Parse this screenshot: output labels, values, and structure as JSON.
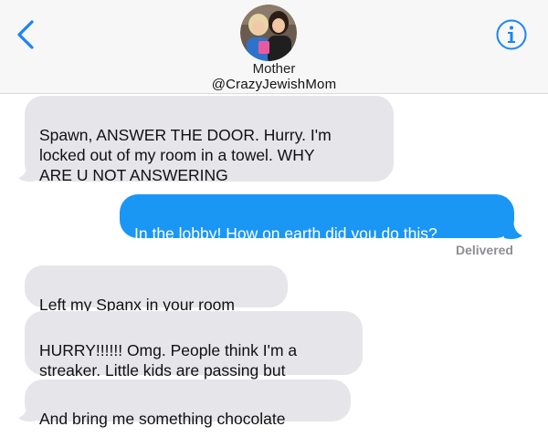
{
  "header": {
    "contact_name": "Mother",
    "contact_handle": "@CrazyJewishMom",
    "back_icon": "chevron-left-icon",
    "info_icon": "info-icon",
    "accent_color": "#1a84f5"
  },
  "messages": [
    {
      "direction": "incoming",
      "text": "Spawn, ANSWER THE DOOR. Hurry. I'm\nlocked out of my room in a towel. WHY\nARE U NOT ANSWERING"
    },
    {
      "direction": "outgoing",
      "text": "In the lobby! How on earth did you do this?"
    },
    {
      "direction": "incoming",
      "text": "Left my Spanx in your room"
    },
    {
      "direction": "incoming",
      "text": "HURRY!!!!!! Omg. People think I'm a\nstreaker. Little kids are passing but"
    },
    {
      "direction": "incoming",
      "text": "And bring me something chocolate"
    }
  ],
  "status": {
    "delivered": "Delivered"
  },
  "colors": {
    "incoming_bubble": "#e5e5ea",
    "outgoing_bubble": "#1a96f5"
  }
}
